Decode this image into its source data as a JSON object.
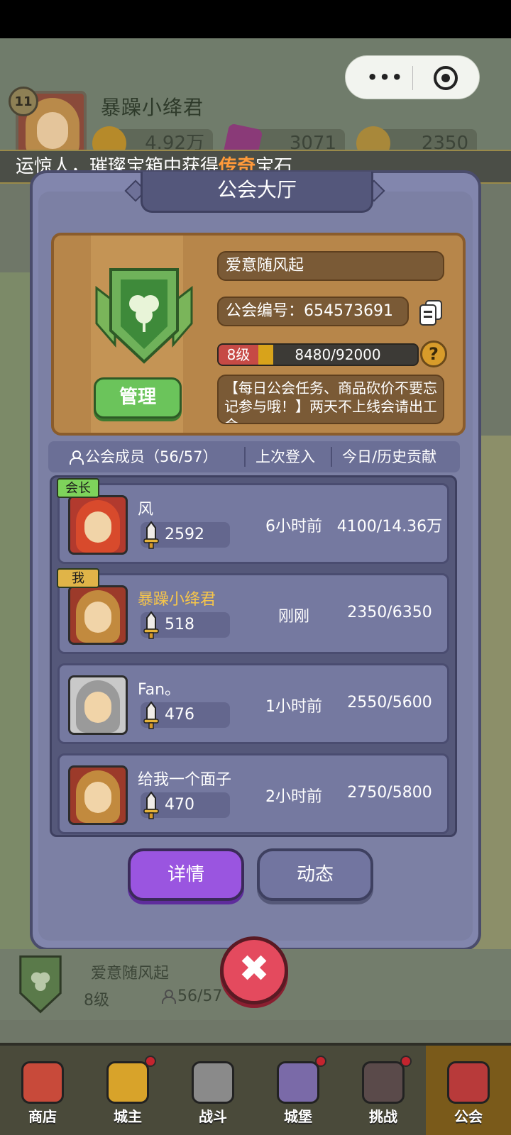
{
  "topbar": {
    "level": "11",
    "player_name": "暴躁小绛君",
    "resources": [
      {
        "icon": "gold-coin-icon",
        "value": "4.92万"
      },
      {
        "icon": "purple-gem-icon",
        "value": "3071"
      },
      {
        "icon": "coin-icon",
        "value": "2350"
      }
    ]
  },
  "capsule": {
    "more": "•••",
    "close": "target-icon"
  },
  "ticker": {
    "text_prefix": "运惊人，璀璨宝箱中获得",
    "highlight": "传奇",
    "text_suffix": "宝石"
  },
  "panel": {
    "title": "公会大厅",
    "guild_name": "爱意随风起",
    "guild_id": "公会编号：654573691",
    "level_label": "8级",
    "xp_text": "8480/92000",
    "xp_progress": 0.092,
    "notice": "【每日公会任务、商品砍价不要忘记参与哦！】两天不上线会请出工会",
    "manage_label": "管理",
    "help_label": "?"
  },
  "columns": {
    "members": "公会成员（56/57）",
    "last_login": "上次登入",
    "contribution": "今日/历史贡献"
  },
  "members": [
    {
      "tag": "会长",
      "name": "风",
      "power": "2592",
      "last_login": "6小时前",
      "contribution": "4100/14.36万",
      "avatar_color": "#b23a2e",
      "hair_color": "#d84a2c",
      "name_color": "#ffffff",
      "tag_color": "#7ed35b"
    },
    {
      "tag": "我",
      "name": "暴躁小绛君",
      "power": "518",
      "last_login": "刚刚",
      "contribution": "2350/6350",
      "avatar_color": "#9c3a2a",
      "hair_color": "#c28a3e",
      "name_color": "#f7c64a",
      "tag_color": "#e0b448"
    },
    {
      "tag": "",
      "name": "Fan。",
      "power": "476",
      "last_login": "1小时前",
      "contribution": "2550/5600",
      "avatar_color": "#c9c9c9",
      "hair_color": "#9a9a9a",
      "name_color": "#ffffff",
      "tag_color": ""
    },
    {
      "tag": "",
      "name": "给我一个面子",
      "power": "470",
      "last_login": "2小时前",
      "contribution": "2750/5800",
      "avatar_color": "#9c3a2a",
      "hair_color": "#c28a3e",
      "name_color": "#ffffff",
      "tag_color": ""
    }
  ],
  "buttons": {
    "detail": "详情",
    "news": "动态",
    "close": "✖"
  },
  "guild_bar": {
    "name": "爱意随风起",
    "level": "8级",
    "members": "56/57"
  },
  "nav": [
    {
      "label": "商店",
      "icon": "shop-icon",
      "color": "#c84a3a"
    },
    {
      "label": "城主",
      "icon": "crown-icon",
      "color": "#d8a32a"
    },
    {
      "label": "战斗",
      "icon": "swords-icon",
      "color": "#8a8a8a"
    },
    {
      "label": "城堡",
      "icon": "castle-icon",
      "color": "#7a6aa8"
    },
    {
      "label": "挑战",
      "icon": "demon-icon",
      "color": "#5a4a4a"
    },
    {
      "label": "公会",
      "icon": "banner-icon",
      "color": "#b83a3a"
    }
  ],
  "colors": {
    "accent": "#9a55e0",
    "close": "#e44a5e",
    "panel": "#8286ad"
  }
}
